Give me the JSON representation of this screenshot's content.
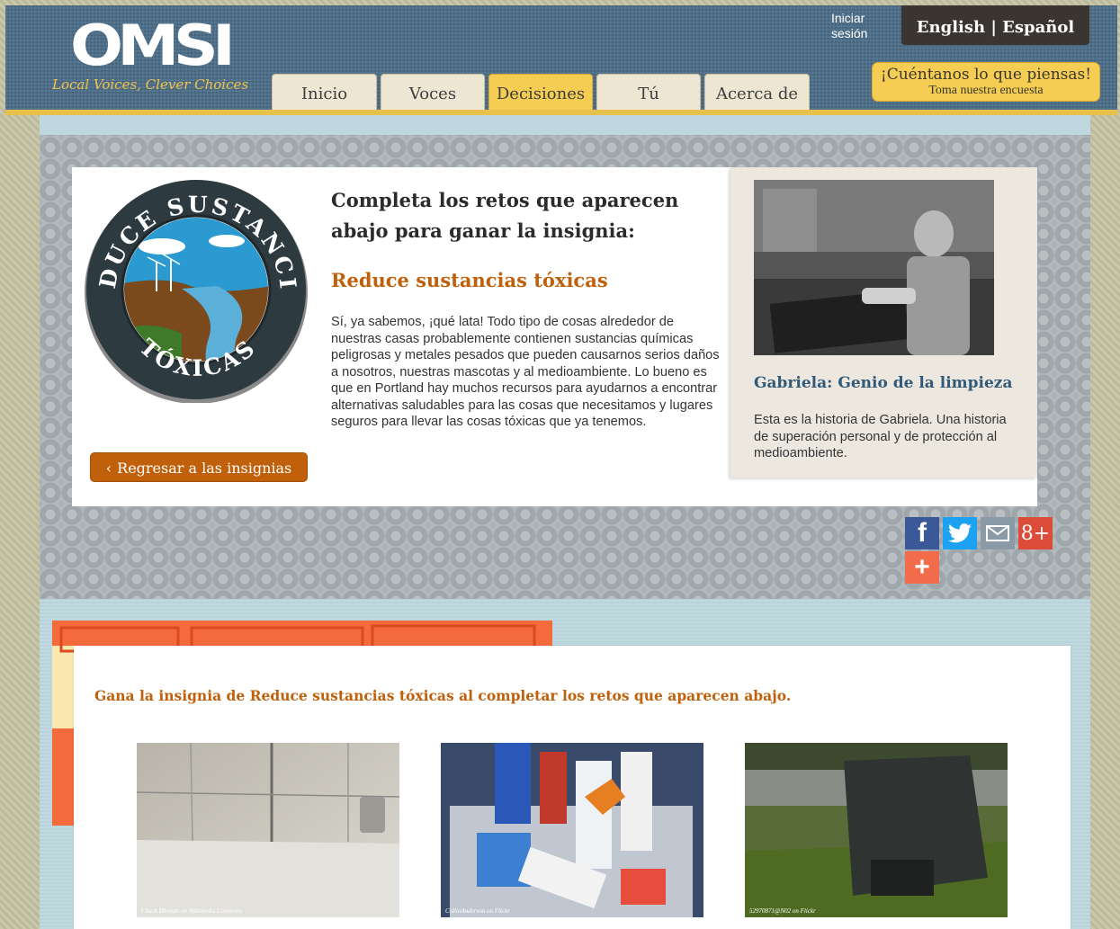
{
  "header": {
    "logo_text": "OMSI",
    "tagline": "Local Voices, Clever Choices",
    "login": "Iniciar sesión",
    "language": "English | Español",
    "survey_title": "¡Cuéntanos lo que piensas!",
    "survey_subtitle": "Toma nuestra encuesta"
  },
  "nav": {
    "tabs": [
      {
        "label": "Inicio",
        "active": false
      },
      {
        "label": "Voces",
        "active": false
      },
      {
        "label": "Decisiones",
        "active": true
      },
      {
        "label": "Tú",
        "active": false
      },
      {
        "label": "Acerca de",
        "active": false
      }
    ]
  },
  "badge": {
    "top_text": "REDUCE SUSTANCIAS",
    "bottom_text": "TÓXICAS",
    "back_button": "Regresar a las insignias"
  },
  "main": {
    "heading": "Completa los retos que aparecen abajo para ganar la insignia:",
    "badge_title": "Reduce sustancias tóxicas",
    "description": "Sí, ya sabemos, ¡qué lata! Todo tipo de cosas alrededor de nuestras casas probablemente contienen sustancias químicas peligrosas y metales pesados que pueden causarnos serios daños a nosotros, nuestras mascotas y al medioambiente. Lo bueno es que en Portland hay muchos recursos para ayudarnos a encontrar alternativas saludables para las cosas que necesitamos y lugares seguros para llevar las cosas tóxicas que ya tenemos."
  },
  "story": {
    "title": "Gabriela: Genio de la limpieza",
    "text": "Esta es la historia de Gabriela. Una historia de superación personal y de protección al medioambiente."
  },
  "share": {
    "facebook": "f",
    "googleplus": "8+",
    "more": "+"
  },
  "challenges": {
    "heading": "Gana la insignia de Reduce sustancias tóxicas al completar los retos que aparecen abajo.",
    "items": [
      {
        "credit": "Chuck Mirman on Wikimedia Commons"
      },
      {
        "credit": "CollinAnderson on Flickr"
      },
      {
        "credit": "52970871@N02 on Flickr"
      }
    ]
  },
  "colors": {
    "header_blue": "#4b6d89",
    "accent_yellow": "#f5cd52",
    "accent_orange": "#c1600b",
    "story_title_blue": "#315a7a"
  }
}
